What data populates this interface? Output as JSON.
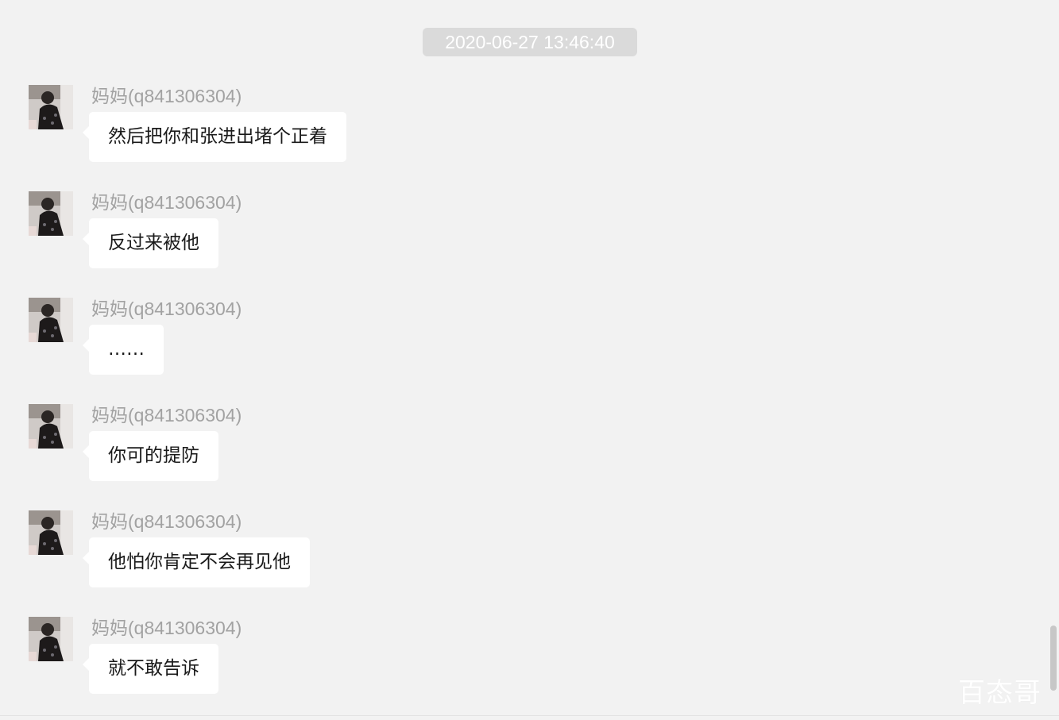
{
  "chat": {
    "timestamp": "2020-06-27 13:46:40",
    "messages": [
      {
        "sender": "妈妈(q841306304)",
        "text": "然后把你和张进出堵个正着"
      },
      {
        "sender": "妈妈(q841306304)",
        "text": "反过来被他"
      },
      {
        "sender": "妈妈(q841306304)",
        "text": "……"
      },
      {
        "sender": "妈妈(q841306304)",
        "text": "你可的提防"
      },
      {
        "sender": "妈妈(q841306304)",
        "text": "他怕你肯定不会再见他"
      },
      {
        "sender": "妈妈(q841306304)",
        "text": "就不敢告诉"
      }
    ]
  },
  "watermark": "百态哥",
  "colors": {
    "background": "#f2f2f2",
    "bubble": "#ffffff",
    "timestamp_bg": "#dadada",
    "sender_text": "#a2a2a2"
  }
}
